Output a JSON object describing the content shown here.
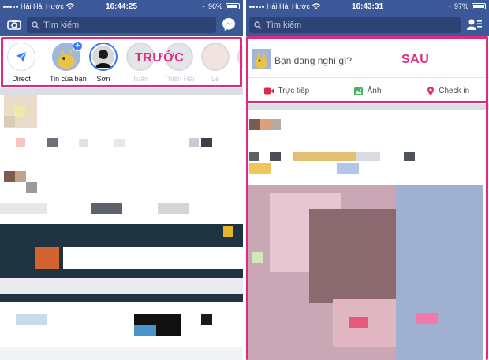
{
  "colors": {
    "facebook_blue": "#3b5998",
    "highlight_pink": "#e0297f"
  },
  "before": {
    "status": {
      "carrier": "Hải Hải Hước",
      "time": "16:44:25",
      "battery": "96%"
    },
    "search_placeholder": "Tìm kiếm",
    "icons": {
      "left": "camera-icon",
      "right": "messenger-icon"
    },
    "tag": "TRƯỚC",
    "stories": [
      {
        "label": "Direct",
        "icon": "direct-send-icon"
      },
      {
        "label": "Tin của bạn",
        "icon": "add-story-icon"
      },
      {
        "label": "Sơn"
      },
      {
        "label": "Tuấn"
      },
      {
        "label": "Thiên Hải"
      },
      {
        "label": "Lê"
      }
    ]
  },
  "after": {
    "status": {
      "carrier": "Hải Hải Hước",
      "time": "16:43:31",
      "battery": "97%"
    },
    "search_placeholder": "Tìm kiếm",
    "icons": {
      "right": "friend-requests-icon"
    },
    "tag": "SAU",
    "composer_prompt": "Bạn đang nghĩ gì?",
    "actions": [
      {
        "label": "Trực tiếp",
        "icon": "live-video-icon",
        "color": "#e42645"
      },
      {
        "label": "Ảnh",
        "icon": "photo-icon",
        "color": "#44b463"
      },
      {
        "label": "Check in",
        "icon": "location-pin-icon",
        "color": "#e1306c"
      }
    ]
  }
}
